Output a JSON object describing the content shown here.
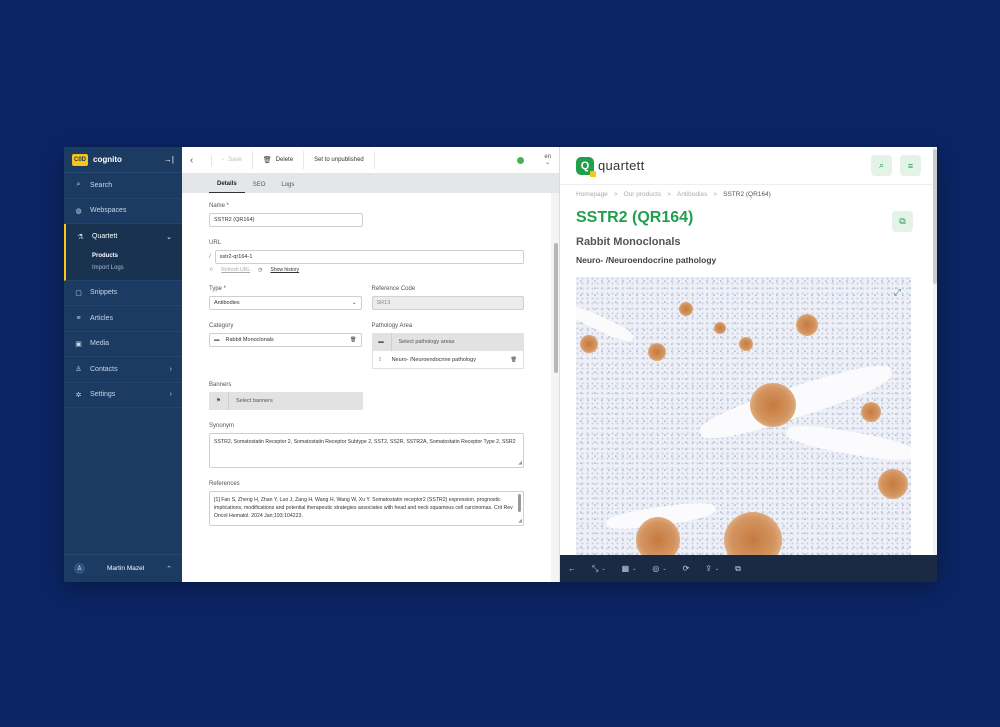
{
  "sidebar": {
    "logo": "C0D",
    "brand": "cognito",
    "collapse_icon": "→|",
    "items": [
      {
        "icon": "search-icon",
        "glyph": "⌕",
        "label": "Search"
      },
      {
        "icon": "globe-icon",
        "glyph": "◍",
        "label": "Webspaces"
      }
    ],
    "group": {
      "glyph": "⚗",
      "label": "Quartett",
      "chevron": "⌄",
      "subitems": [
        {
          "label": "Products"
        },
        {
          "label": "Import Logs"
        }
      ]
    },
    "items2": [
      {
        "icon": "snippets-icon",
        "glyph": "▢",
        "label": "Snippets",
        "chevron": ""
      },
      {
        "icon": "articles-icon",
        "glyph": "≡",
        "label": "Articles",
        "chevron": ""
      },
      {
        "icon": "media-icon",
        "glyph": "▣",
        "label": "Media",
        "chevron": ""
      },
      {
        "icon": "contacts-icon",
        "glyph": "♙",
        "label": "Contacts",
        "chevron": "›"
      },
      {
        "icon": "settings-icon",
        "glyph": "✲",
        "label": "Settings",
        "chevron": "›"
      }
    ],
    "user": {
      "glyph": "♙",
      "name": "Martin Mazel",
      "chevron": "⌃"
    }
  },
  "toolbar": {
    "back": "‹",
    "save_icon": "▫",
    "save": "Save",
    "delete_icon": "🗑",
    "delete": "Delete",
    "unpublish": "Set to unpublished",
    "lang": "en",
    "lang_chevron": "⌄",
    "status_color": "#4caf50"
  },
  "tabs": [
    {
      "label": "Details"
    },
    {
      "label": "SEO"
    },
    {
      "label": "Logs"
    }
  ],
  "form": {
    "name_label": "Name *",
    "name_value": "SSTR2 (QR164)",
    "url_label": "URL",
    "url_prefix": "/",
    "url_value": "sstr2-qr164-1",
    "refresh_icon": "⟲",
    "refresh_url": "Refresh URL",
    "history_icon": "◷",
    "show_history": "Show history",
    "type_label": "Type *",
    "type_value": "Antibodies",
    "type_chevron": "⌄",
    "refcode_label": "Reference Code",
    "refcode_value": "SR13",
    "category_label": "Category",
    "category_icon": "▬",
    "category_value": "Rabbit Monoclonals",
    "trash_icon": "🗑",
    "pathology_label": "Pathology Area",
    "pathology_folder_icon": "▬",
    "pathology_placeholder": "Select pathology areas",
    "pathology_item_handle": "⁞⁞",
    "pathology_item": "Neuro- /Neuroendocrine pathology",
    "banners_label": "Banners",
    "banners_icon": "⚑",
    "banners_placeholder": "Select banners",
    "synonym_label": "Synonym",
    "synonym_value": "SSTR2, Somatostatin Receptor 2, Somatostatin Receptor Subtype 2, SST2, SS2R, SSTR2A, Somatostatin Receptor Type 2, SSR2",
    "references_label": "References",
    "references_value": "[1] Fan S, Zheng H, Zhan Y, Luo J, Zang H, Wang H, Wang W, Xu Y. Somatostatin receptor2 (SSTR2) expression, prognostic implications, modifications and potential therapeutic strategies associates with head and neck squamous cell carcinomas. Crit Rev Oncol Hematol. 2024 Jan;193:104223.",
    "resize_glyph": "◢"
  },
  "preview": {
    "logo_letter": "Q",
    "logo_text": "quartett",
    "search_glyph": "⌕",
    "menu_glyph": "≡",
    "copy_glyph": "⧉",
    "expand_glyph": "⤢",
    "breadcrumb": [
      "Homepage",
      ">",
      "Our products",
      ">",
      "Antibodies",
      ">",
      "SSTR2 (QR164)"
    ],
    "title": "SSTR2 (QR164)",
    "subtitle": "Rabbit Monoclonals",
    "subtitle2": "Neuro- /Neuroendocrine pathology",
    "brand_color": "#20a04b"
  },
  "bottom_bar": {
    "back_glyph": "←",
    "resize_glyph": "⤡",
    "calendar_glyph": "▦",
    "target_glyph": "◎",
    "refresh_glyph": "⟳",
    "share_glyph": "⇪",
    "external_glyph": "⧉",
    "chevron": "⌄"
  }
}
